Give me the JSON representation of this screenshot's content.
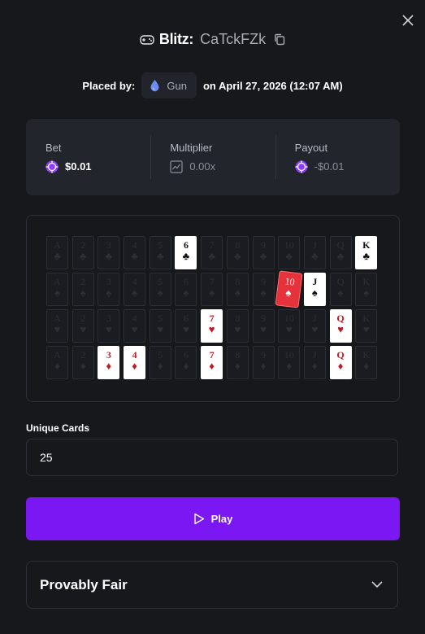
{
  "header": {
    "game_name": "Blitz:",
    "bet_id": "CaTckFZk",
    "icons": {
      "game": "gamepad-icon",
      "copy": "copy-icon",
      "close": "close-icon"
    }
  },
  "placement": {
    "placed_by_label": "Placed by:",
    "username": "Gun",
    "user_icon": "droplet-icon",
    "date_text": "on April 27, 2026 (12:07 AM)"
  },
  "stats": {
    "bet": {
      "label": "Bet",
      "value": "$0.01",
      "icon": "chip-icon"
    },
    "multiplier": {
      "label": "Multiplier",
      "value": "0.00x",
      "icon": "chart-icon"
    },
    "payout": {
      "label": "Payout",
      "value": "-$0.01",
      "icon": "chip-icon"
    }
  },
  "board": {
    "ranks": [
      "A",
      "2",
      "3",
      "4",
      "5",
      "6",
      "7",
      "8",
      "9",
      "10",
      "J",
      "Q",
      "K"
    ],
    "rows": [
      {
        "suit": "♣",
        "color": "black",
        "selected": [
          5,
          12
        ],
        "highlighted": []
      },
      {
        "suit": "♠",
        "color": "black",
        "selected": [
          10
        ],
        "highlighted": [
          9
        ]
      },
      {
        "suit": "♥",
        "color": "red",
        "selected": [
          6,
          11
        ],
        "highlighted": []
      },
      {
        "suit": "♦",
        "color": "red",
        "selected": [
          2,
          3,
          6,
          11
        ],
        "highlighted": []
      }
    ]
  },
  "unique_cards": {
    "label": "Unique Cards",
    "value": "25"
  },
  "play_button": {
    "label": "Play",
    "icon": "play-icon"
  },
  "provably_fair": {
    "title": "Provably Fair",
    "icon": "chevron-down-icon"
  },
  "colors": {
    "accent": "#7a17f2",
    "background": "#17181c",
    "panel": "#22252c",
    "red_card": "#e5323b"
  }
}
